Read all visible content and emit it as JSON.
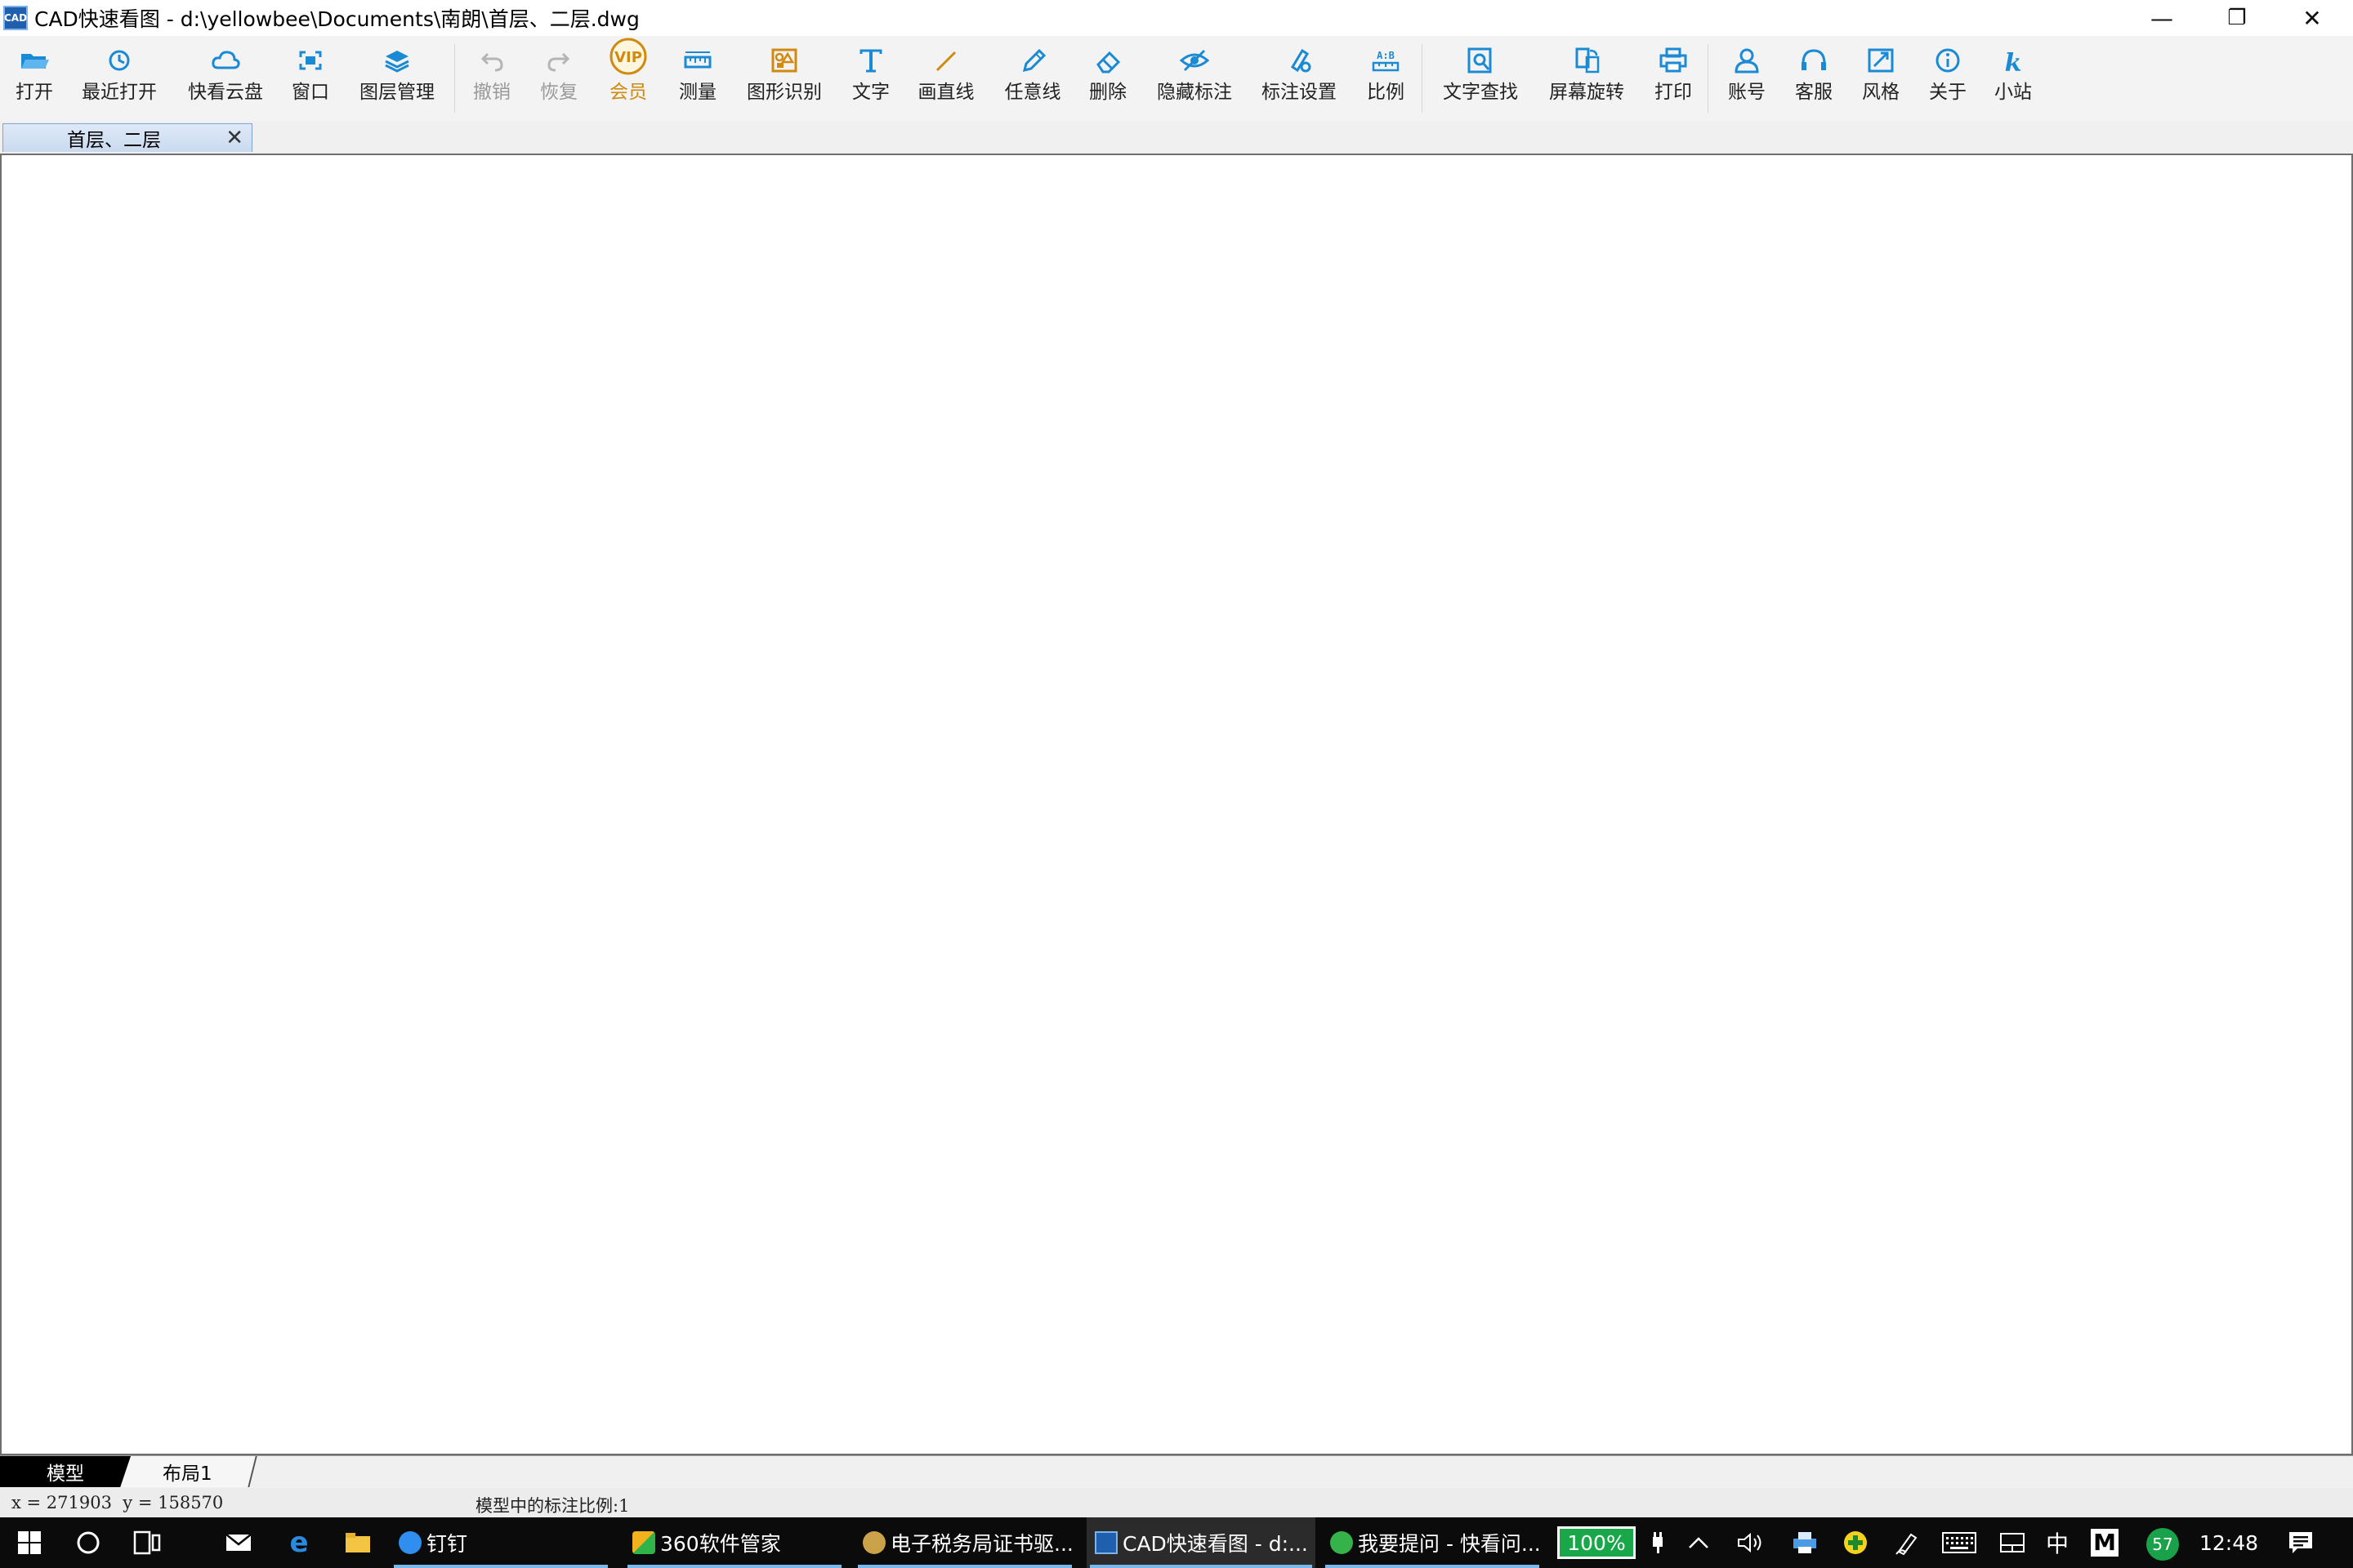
{
  "window": {
    "app_icon_text": "CAD",
    "title": "CAD快速看图 - d:\\yellowbee\\Documents\\南朗\\首层、二层.dwg",
    "minimize_glyph": "—",
    "restore_glyph": "❐",
    "close_glyph": "✕"
  },
  "toolbar": {
    "items": [
      {
        "label": "打开",
        "icon": "folder-open-icon",
        "color": "#1a8ad4"
      },
      {
        "label": "最近打开",
        "icon": "recent-clock-icon",
        "color": "#1a8ad4"
      },
      {
        "label": "快看云盘",
        "icon": "cloud-icon",
        "color": "#1a8ad4"
      },
      {
        "label": "窗口",
        "icon": "window-frame-icon",
        "color": "#1a8ad4"
      },
      {
        "label": "图层管理",
        "icon": "layers-icon",
        "color": "#1a8ad4"
      },
      {
        "label": "撤销",
        "icon": "undo-icon",
        "color": "#b5b5b5",
        "disabled": true
      },
      {
        "label": "恢复",
        "icon": "redo-icon",
        "color": "#b5b5b5",
        "disabled": true
      },
      {
        "label": "会员",
        "icon": "vip-icon",
        "color": "#d08a10"
      },
      {
        "label": "测量",
        "icon": "ruler-icon",
        "color": "#1a8ad4"
      },
      {
        "label": "图形识别",
        "icon": "shape-recognize-icon",
        "color": "#d08a10"
      },
      {
        "label": "文字",
        "icon": "text-icon",
        "color": "#1a8ad4"
      },
      {
        "label": "画直线",
        "icon": "line-icon",
        "color": "#d08a10"
      },
      {
        "label": "任意线",
        "icon": "pen-icon",
        "color": "#1a8ad4"
      },
      {
        "label": "删除",
        "icon": "eraser-icon",
        "color": "#1a8ad4"
      },
      {
        "label": "隐藏标注",
        "icon": "hide-eye-icon",
        "color": "#1a8ad4"
      },
      {
        "label": "标注设置",
        "icon": "annotation-settings-icon",
        "color": "#1a8ad4"
      },
      {
        "label": "比例",
        "icon": "scale-icon",
        "color": "#1a8ad4"
      },
      {
        "label": "文字查找",
        "icon": "text-search-icon",
        "color": "#1a8ad4"
      },
      {
        "label": "屏幕旋转",
        "icon": "rotate-screen-icon",
        "color": "#1a8ad4"
      },
      {
        "label": "打印",
        "icon": "printer-icon",
        "color": "#1a8ad4"
      },
      {
        "label": "账号",
        "icon": "user-icon",
        "color": "#1a8ad4"
      },
      {
        "label": "客服",
        "icon": "headset-icon",
        "color": "#1a8ad4"
      },
      {
        "label": "风格",
        "icon": "style-icon",
        "color": "#1a8ad4"
      },
      {
        "label": "关于",
        "icon": "info-icon",
        "color": "#1a8ad4"
      },
      {
        "label": "小站",
        "icon": "k-site-icon",
        "color": "#1a8ad4"
      }
    ],
    "vip_badge_text": "VIP"
  },
  "document_tab": {
    "label": "首层、二层",
    "close_glyph": "✕"
  },
  "layout_tabs": [
    "模型",
    "布局1"
  ],
  "status": {
    "coords": "x = 271903  y = 158570",
    "scale_text": "模型中的标注比例:1"
  },
  "taskbar": {
    "apps": [
      {
        "label": "钉钉",
        "icon": "dingtalk-icon",
        "color": "#2f8ef0"
      },
      {
        "label": "360软件管家",
        "icon": "360-manager-icon",
        "color": "#f2b21e"
      },
      {
        "label": "电子税务局证书驱...",
        "icon": "tax-bureau-icon",
        "color": "#c9a24a"
      },
      {
        "label": "CAD快速看图 - d:...",
        "icon": "cad-viewer-icon",
        "color": "#1f5fae"
      },
      {
        "label": "我要提问 - 快看问...",
        "icon": "browser-360-icon",
        "color": "#35b34a"
      }
    ],
    "battery_text": "100%",
    "ime_text": "中",
    "m_text": "M",
    "badge_text": "57",
    "time": "12:48"
  }
}
